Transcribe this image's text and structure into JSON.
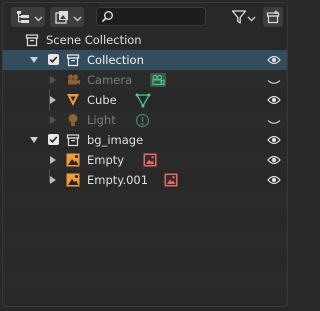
{
  "header": {
    "display_mode_icon": "outliner-display-mode-icon",
    "filter_dropdown_icon": "object-filter-icon",
    "search": {
      "value": "",
      "placeholder": ""
    },
    "filter_icon": "funnel-icon",
    "new_collection_icon": "new-collection-icon"
  },
  "tree": {
    "scene_collection": "Scene Collection",
    "collection": {
      "label": "Collection",
      "children": {
        "camera": "Camera",
        "cube": "Cube",
        "light": "Light"
      }
    },
    "bg_image": {
      "label": "bg_image",
      "children": {
        "empty": "Empty",
        "empty001": "Empty.001"
      }
    }
  },
  "colors": {
    "selected_row": "#334d5e",
    "object_orange": "#f09a3e",
    "data_green": "#55cc88",
    "image_red": "#e06a6a"
  }
}
